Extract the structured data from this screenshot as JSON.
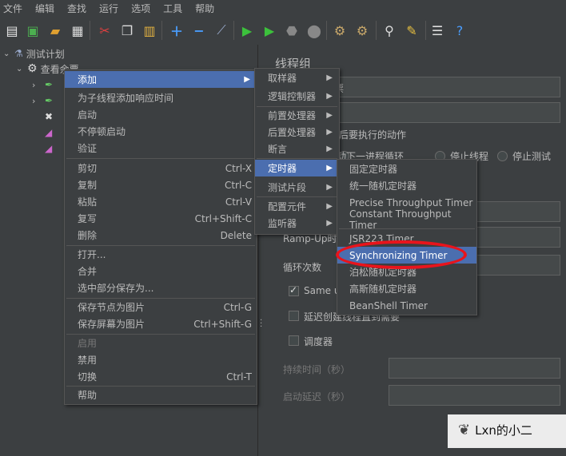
{
  "menubar": {
    "items": [
      "文件",
      "编辑",
      "查找",
      "运行",
      "选项",
      "工具",
      "帮助"
    ]
  },
  "tree": {
    "root": "测试计划",
    "thread_group": "查看余票"
  },
  "context_menu": {
    "items": [
      {
        "label": "添加",
        "shortcut": "",
        "submenu": true,
        "selected": true
      },
      {
        "label": "为子线程添加响应时间",
        "shortcut": ""
      },
      {
        "label": "启动",
        "shortcut": ""
      },
      {
        "label": "不停顿启动",
        "shortcut": ""
      },
      {
        "label": "验证",
        "shortcut": ""
      },
      {
        "label": "剪切",
        "shortcut": "Ctrl-X"
      },
      {
        "label": "复制",
        "shortcut": "Ctrl-C"
      },
      {
        "label": "粘贴",
        "shortcut": "Ctrl-V"
      },
      {
        "label": "复写",
        "shortcut": "Ctrl+Shift-C"
      },
      {
        "label": "删除",
        "shortcut": "Delete"
      },
      {
        "label": "打开...",
        "shortcut": ""
      },
      {
        "label": "合并",
        "shortcut": ""
      },
      {
        "label": "选中部分保存为...",
        "shortcut": ""
      },
      {
        "label": "保存节点为图片",
        "shortcut": "Ctrl-G"
      },
      {
        "label": "保存屏幕为图片",
        "shortcut": "Ctrl+Shift-G"
      },
      {
        "label": "启用",
        "shortcut": "",
        "disabled": true
      },
      {
        "label": "禁用",
        "shortcut": ""
      },
      {
        "label": "切换",
        "shortcut": "Ctrl-T"
      },
      {
        "label": "帮助",
        "shortcut": ""
      }
    ]
  },
  "add_submenu": {
    "items": [
      "取样器",
      "逻辑控制器",
      "前置处理器",
      "后置处理器",
      "断言",
      "定时器",
      "测试片段",
      "配置元件",
      "监听器"
    ],
    "selected": "定时器"
  },
  "timer_submenu": {
    "items": [
      "固定定时器",
      "统一随机定时器",
      "Precise Throughput Timer",
      "Constant Throughput Timer",
      "JSR223 Timer",
      "Synchronizing Timer",
      "泊松随机定时器",
      "高斯随机定时器",
      "BeanShell Timer"
    ],
    "selected": "Synchronizing Timer"
  },
  "panel": {
    "title": "线程组",
    "name_value_fragment": "票",
    "action_label_fragment": "后要执行的动作",
    "radio_options": [
      "启动下一进程循环",
      "停止线程",
      "停止测试"
    ],
    "rampup_label": "Ramp-Up时",
    "loop_label": "循环次数",
    "same_user_label": "Same u",
    "delay_label": "延迟创建线程直到需要",
    "scheduler_label": "调度器",
    "duration_label": "持续时间（秒）",
    "startup_delay_label": "启动延迟（秒）"
  },
  "watermark": {
    "text": "Lxn的小二"
  },
  "colors": {
    "selection": "#4b6eaf",
    "highlight": "#e8141c",
    "background": "#3c3f41"
  }
}
